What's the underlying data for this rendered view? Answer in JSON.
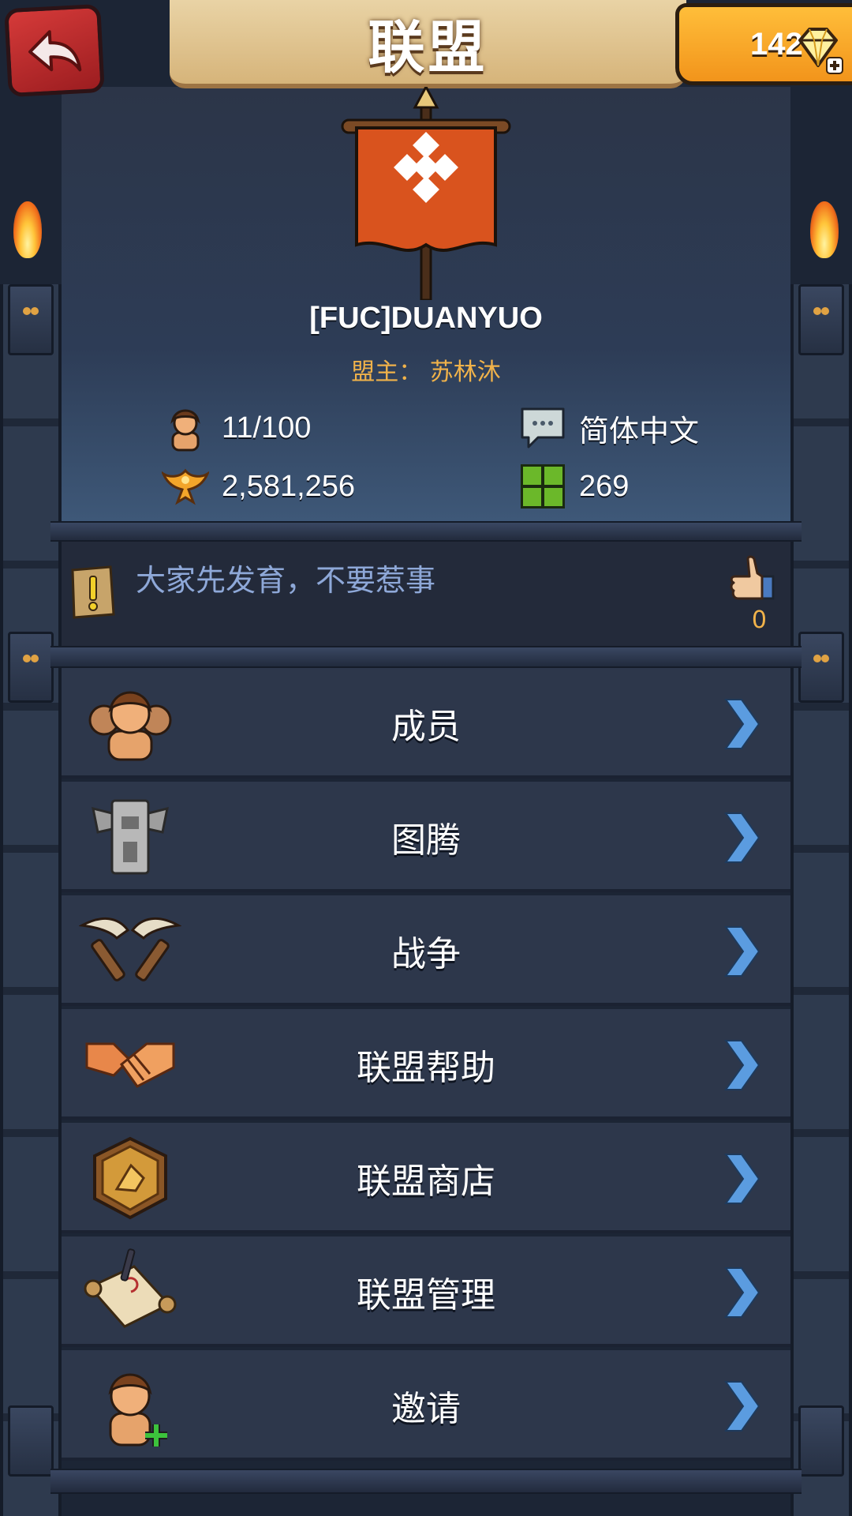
{
  "header": {
    "title": "联盟",
    "back_icon": "back-arrow-icon",
    "gems": "142",
    "gem_icon": "diamond-plus-icon"
  },
  "alliance": {
    "banner_icon": "alliance-banner-icon",
    "name": "[FUC]DUANYUO",
    "leader": "盟主： 苏林沐",
    "members": "11/100",
    "power": "2,581,256",
    "language": "简体中文",
    "territory": "269"
  },
  "notice": {
    "text": "大家先发育，不要惹事",
    "likes": "0"
  },
  "menu": [
    {
      "label": "成员",
      "icon": "members-icon"
    },
    {
      "label": "图腾",
      "icon": "totem-icon"
    },
    {
      "label": "战争",
      "icon": "war-icon"
    },
    {
      "label": "联盟帮助",
      "icon": "handshake-icon"
    },
    {
      "label": "联盟商店",
      "icon": "shop-icon"
    },
    {
      "label": "联盟管理",
      "icon": "scroll-manage-icon"
    },
    {
      "label": "邀请",
      "icon": "invite-icon"
    }
  ],
  "colors": {
    "accent_gold": "#f0b24a",
    "chevron_blue": "#5b9ce0",
    "banner_orange": "#d9531e",
    "notice_text": "#8ea8d8"
  }
}
